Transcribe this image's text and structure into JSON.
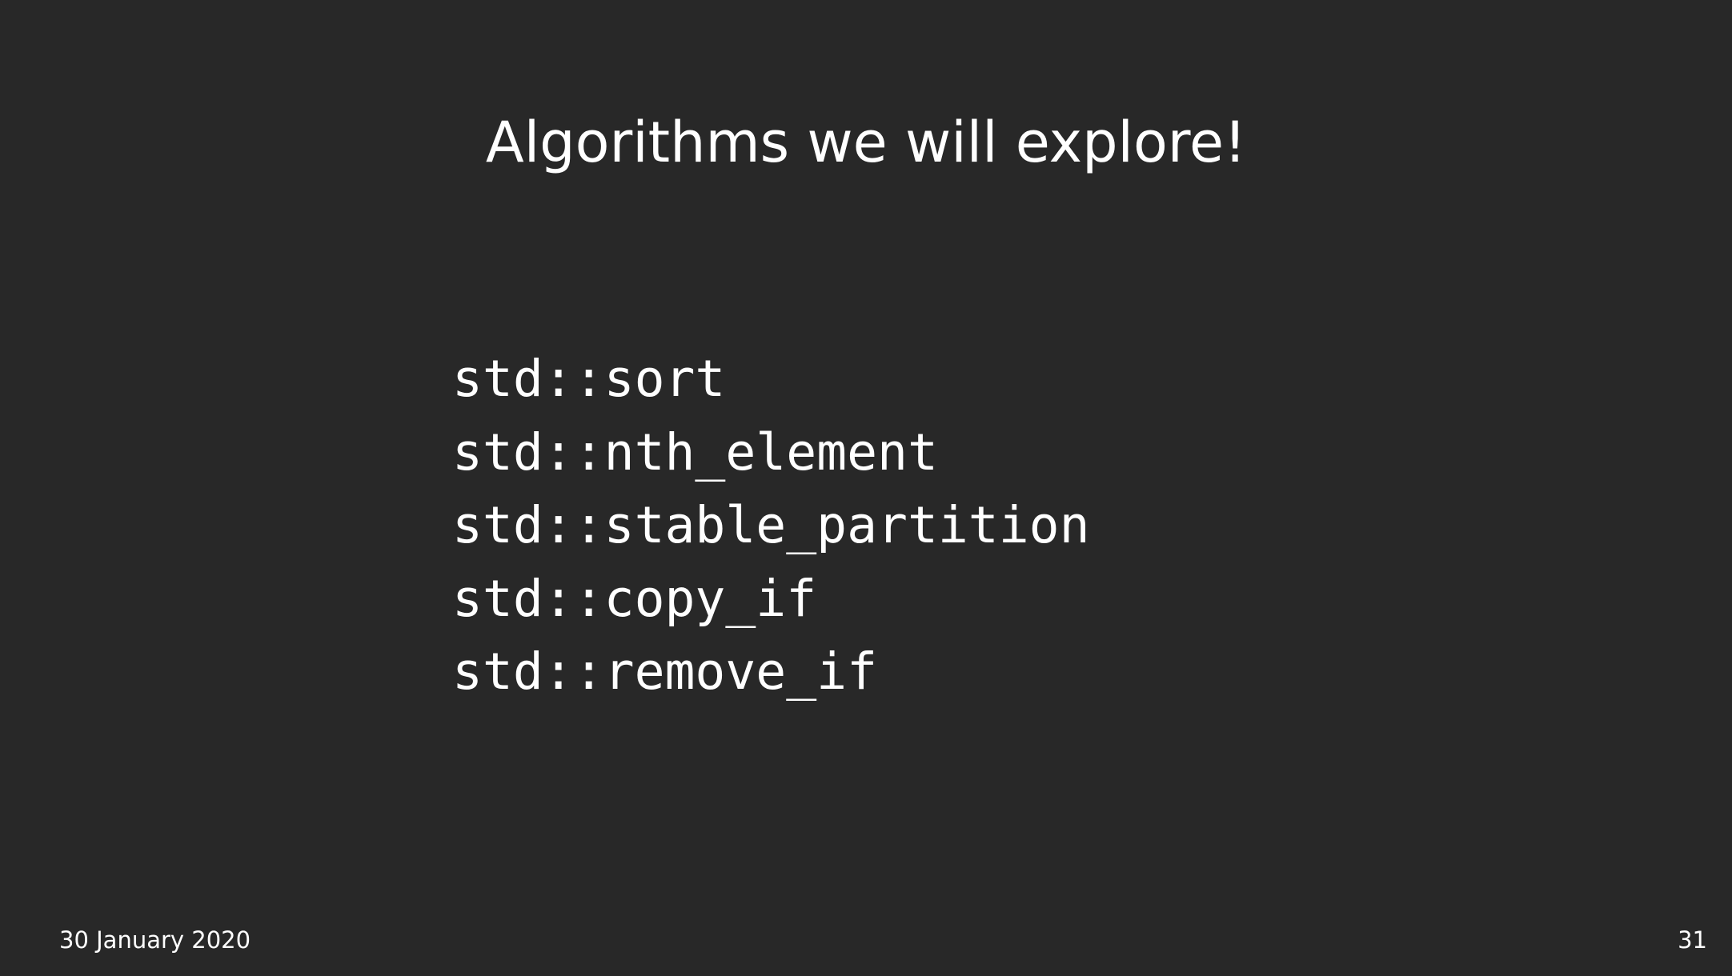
{
  "slide": {
    "title": "Algorithms we will explore!",
    "algorithms": [
      "std::sort",
      "std::nth_element",
      "std::stable_partition",
      "std::copy_if",
      "std::remove_if"
    ],
    "footer": {
      "date": "30 January 2020",
      "page_number": "31"
    }
  },
  "colors": {
    "background": "#282828",
    "text": "#ffffff"
  }
}
